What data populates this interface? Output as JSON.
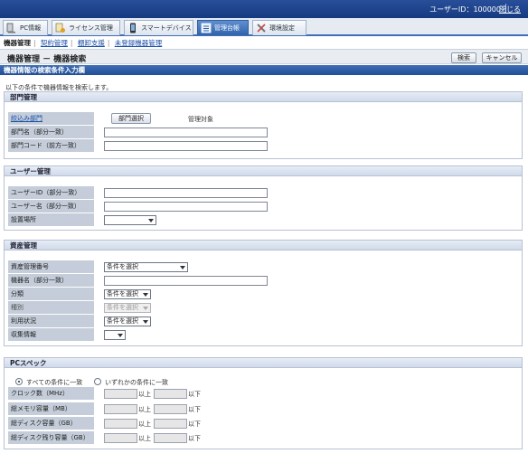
{
  "header": {
    "user_label": "ユーザーID：100000",
    "logout": "閉じる"
  },
  "tabs": [
    {
      "label": "PC情報",
      "icon": "pc-icon"
    },
    {
      "label": "ライセンス管理",
      "icon": "license-icon"
    },
    {
      "label": "スマートデバイス",
      "icon": "smartdevice-icon"
    },
    {
      "label": "管理台帳",
      "icon": "ledger-icon",
      "active": true
    },
    {
      "label": "環境設定",
      "icon": "settings-icon"
    }
  ],
  "subnav": {
    "current": "機器管理",
    "links": [
      "契約管理",
      "棚卸支援",
      "未登録機器管理"
    ]
  },
  "page": {
    "title": "機器管理 － 機器検索",
    "search_button": "検索",
    "cancel_button": "キャンセル"
  },
  "section_title": "機器情報の検索条件入力欄",
  "instruction": "以下の条件で機器情報を検索します。",
  "dept": {
    "title": "部門管理",
    "filter_label": "絞込み部門",
    "dept_select_button": "部門選択",
    "managed_text": "管理対象",
    "name_label": "部門名（部分一致）",
    "code_label": "部門コード（前方一致）"
  },
  "user": {
    "title": "ユーザー管理",
    "id_label": "ユーザーID（部分一致）",
    "name_label": "ユーザー名（部分一致）",
    "location_label": "設置場所"
  },
  "asset": {
    "title": "資産管理",
    "number_label": "資産管理番号",
    "number_value": "条件を選択",
    "device_name_label": "機器名（部分一致）",
    "category_label": "分類",
    "category_value": "条件を選択",
    "type_label": "種別",
    "type_value": "条件を選択",
    "usage_label": "利用状況",
    "usage_value": "条件を選択",
    "collect_label": "収集情報"
  },
  "pcspec": {
    "title": "PCスペック",
    "radio_all": "すべての条件に一致",
    "radio_any": "いずれかの条件に一致",
    "rows": [
      {
        "label": "クロック数（MHz）"
      },
      {
        "label": "総メモリ容量（MB）"
      },
      {
        "label": "総ディスク容量（GB）"
      },
      {
        "label": "総ディスク残り容量（GB）"
      }
    ],
    "above": "以上",
    "below": "以下"
  }
}
